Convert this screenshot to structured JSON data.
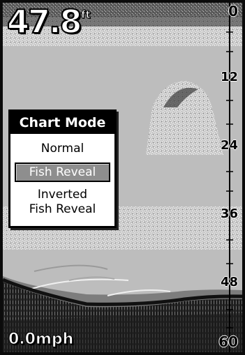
{
  "depth_readout": {
    "value": "47.8",
    "unit": "ft"
  },
  "speed_readout": {
    "value": "0.0mph"
  },
  "depth_scale": {
    "labels": [
      "0",
      "12",
      "24",
      "36",
      "48",
      "60"
    ]
  },
  "chart_mode_menu": {
    "title": "Chart Mode",
    "items": [
      {
        "label": "Normal"
      },
      {
        "label": "Fish Reveal"
      },
      {
        "label_line1": "Inverted",
        "label_line2": "Fish Reveal"
      }
    ],
    "selected_index": 1
  },
  "colors": {
    "background": "#bdbdbd",
    "noise": "#f2f2f2",
    "bottom_dark": "#1c1c1c",
    "bottom_mid": "#7a7a7a",
    "menu_title_bg": "#000000",
    "highlight": "#8e8e8e"
  }
}
